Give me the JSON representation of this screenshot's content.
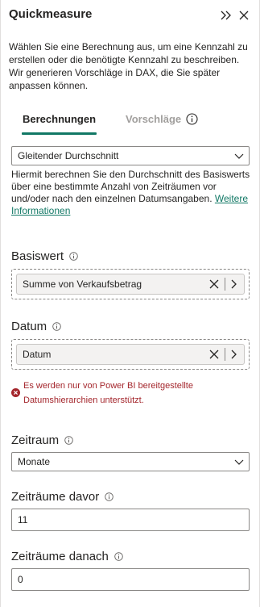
{
  "header": {
    "title": "Quickmeasure",
    "collapse_icon": "double-chevron-right-icon",
    "close_icon": "close-icon"
  },
  "intro": "Wählen Sie eine Berechnung aus, um eine Kennzahl zu erstellen oder die benötigte Kennzahl zu beschreiben. Wir generieren Vorschläge in DAX, die Sie später anpassen können.",
  "tabs": [
    {
      "label": "Berechnungen",
      "active": true
    },
    {
      "label": "Vorschläge",
      "active": false,
      "icon": "info-icon"
    }
  ],
  "calculation": {
    "selected": "Gleitender Durchschnitt",
    "description": "Hiermit berechnen Sie den Durchschnitt des Basiswerts über eine bestimmte Anzahl von Zeiträumen vor und/oder nach den einzelnen Datumsangaben.",
    "link_text": "Weitere Informationen"
  },
  "basiswert": {
    "label": "Basiswert",
    "field": "Summe von Verkaufsbetrag"
  },
  "datum": {
    "label": "Datum",
    "field": "Datum"
  },
  "error": {
    "text": "Es werden nur von Power BI bereitgestellte Datumshierarchien unterstützt.",
    "icon": "error-circle-icon"
  },
  "zeitraum": {
    "label": "Zeitraum",
    "selected": "Monate"
  },
  "davor": {
    "label": "Zeiträume davor",
    "value": "11"
  },
  "danach": {
    "label": "Zeiträume danach",
    "value": "0"
  },
  "colors": {
    "accent": "#117865",
    "error": "#a4262c",
    "muted": "#a19f9d"
  }
}
